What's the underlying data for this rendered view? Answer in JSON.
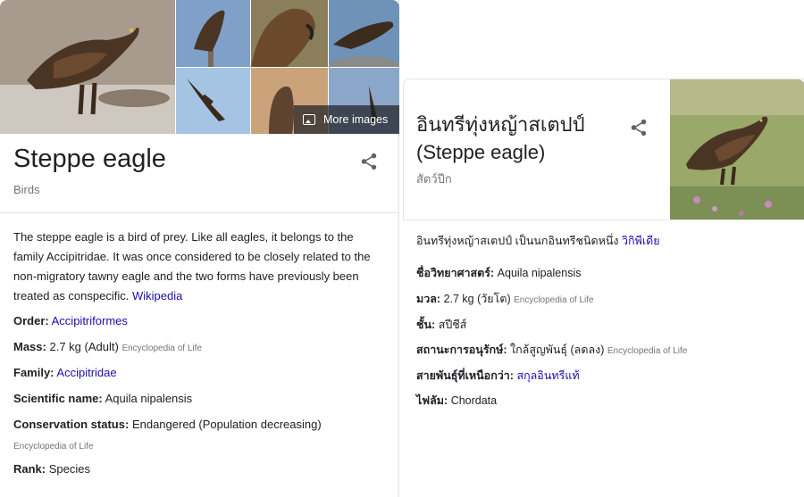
{
  "left_panel": {
    "more_images_label": "More images",
    "title": "Steppe eagle",
    "subtitle": "Birds",
    "description": "The steppe eagle is a bird of prey. Like all eagles, it belongs to the family Accipitridae. It was once considered to be closely related to the non-migratory tawny eagle and the two forms have previously been treated as conspecific.",
    "description_link": "Wikipedia",
    "facts": [
      {
        "label": "Order:",
        "value": "",
        "link": "Accipitriformes",
        "source": "",
        "source2": ""
      },
      {
        "label": "Mass:",
        "value": "2.7 kg (Adult)",
        "link": "",
        "source": "Encyclopedia of Life",
        "source2": ""
      },
      {
        "label": "Family:",
        "value": "",
        "link": "Accipitridae",
        "source": "",
        "source2": ""
      },
      {
        "label": "Scientific name:",
        "value": "Aquila nipalensis",
        "link": "",
        "source": "",
        "source2": ""
      },
      {
        "label": "Conservation status:",
        "value": "Endangered (Population decreasing)",
        "link": "",
        "source": "",
        "source2": "Encyclopedia of Life"
      },
      {
        "label": "Rank:",
        "value": "Species",
        "link": "",
        "source": "",
        "source2": ""
      }
    ]
  },
  "right_panel": {
    "title_line1": "อินทรีทุ่งหญ้าสเตปป์",
    "title_line2": "(Steppe eagle)",
    "subtitle": "สัตว์ปีก",
    "description": "อินทรีทุ่งหญ้าสเตปป์ เป็นนกอินทรีชนิดหนึ่ง",
    "description_link": "วิกิพีเดีย",
    "facts": [
      {
        "label": "ชื่อวิทยาศาสตร์:",
        "value": "Aquila nipalensis",
        "link": "",
        "source": ""
      },
      {
        "label": "มวล:",
        "value": "2.7 kg (วัยโต)",
        "link": "",
        "source": "Encyclopedia of Life"
      },
      {
        "label": "ชั้น:",
        "value": "สปีชีส์",
        "link": "",
        "source": ""
      },
      {
        "label": "สถานะการอนุรักษ์:",
        "value": "ใกล้สูญพันธุ์ (ลดลง)",
        "link": "",
        "source": "Encyclopedia of Life"
      },
      {
        "label": "สายพันธุ์ที่เหนือกว่า:",
        "value": "",
        "link": "สกุลอินทรีแท้",
        "source": ""
      },
      {
        "label": "ไฟลัม:",
        "value": "Chordata",
        "link": "",
        "source": ""
      }
    ]
  },
  "icons": {
    "share": "share-icon",
    "more_images": "image-icon"
  },
  "colors": {
    "link": "#1a0dab",
    "text": "#202124",
    "secondary_text": "#70757a",
    "divider": "#e6e6e6"
  }
}
